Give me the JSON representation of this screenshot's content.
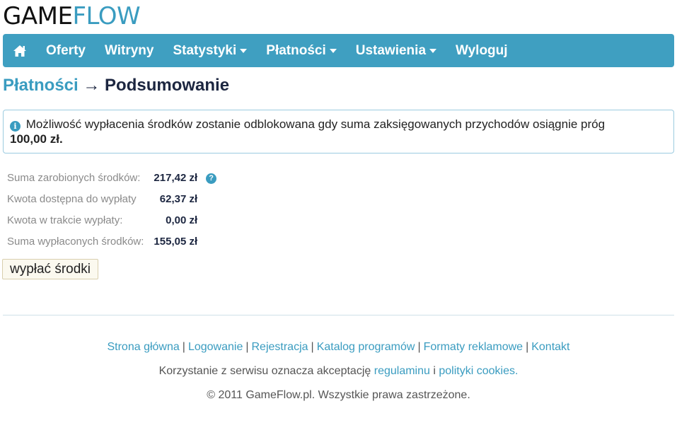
{
  "logo": {
    "part1": "GAME",
    "part2": "FLOW"
  },
  "nav": {
    "home_icon": "home-icon",
    "items": [
      {
        "label": "Oferty",
        "dropdown": false
      },
      {
        "label": "Witryny",
        "dropdown": false
      },
      {
        "label": "Statystyki",
        "dropdown": true
      },
      {
        "label": "Płatności",
        "dropdown": true
      },
      {
        "label": "Ustawienia",
        "dropdown": true
      },
      {
        "label": "Wyloguj",
        "dropdown": false
      }
    ]
  },
  "title": {
    "crumb": "Płatności",
    "arrow": "→",
    "current": "Podsumowanie"
  },
  "alert": {
    "icon": "info-icon",
    "text": "Możliwość wypłacenia środków zostanie odblokowana gdy suma zaksięgowanych przychodów osiągnie próg",
    "amount": "100,00 zł."
  },
  "summary": [
    {
      "label": "Suma zarobionych środków:",
      "value": "217,42 zł",
      "help": "?"
    },
    {
      "label": "Kwota dostępna do wypłaty",
      "value": "62,37 zł"
    },
    {
      "label": "Kwota w trakcie wypłaty:",
      "value": "0,00 zł"
    },
    {
      "label": "Suma wypłaconych środków:",
      "value": "155,05 zł"
    }
  ],
  "withdraw_button": "wypłać środki",
  "footer": {
    "links": [
      "Strona główna",
      "Logowanie",
      "Rejestracja",
      "Katalog programów",
      "Formaty reklamowe",
      "Kontakt"
    ],
    "separator": "|",
    "terms_prefix": "Korzystanie z serwisu oznacza akceptację",
    "terms_link1": "regulaminu",
    "terms_mid": "i",
    "terms_link2": "polityki cookies",
    "terms_suffix": ".",
    "copyright": "© 2011 GameFlow.pl. Wszystkie prawa zastrzeżone."
  },
  "colors": {
    "accent": "#3f9fc1",
    "link": "#3a9cc0",
    "title": "#1c2640"
  }
}
